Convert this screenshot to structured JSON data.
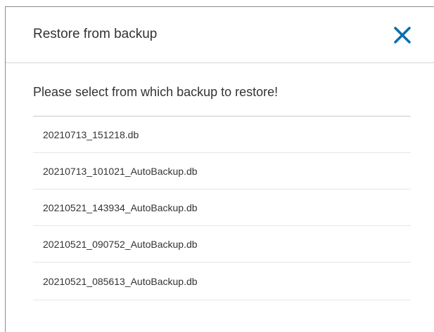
{
  "dialog": {
    "title": "Restore from backup",
    "close_icon": "close-icon",
    "accent_color": "#0a6fae",
    "prompt": "Please select from which backup to restore!",
    "backups": [
      "20210713_151218.db",
      "20210713_101021_AutoBackup.db",
      "20210521_143934_AutoBackup.db",
      "20210521_090752_AutoBackup.db",
      "20210521_085613_AutoBackup.db"
    ]
  }
}
